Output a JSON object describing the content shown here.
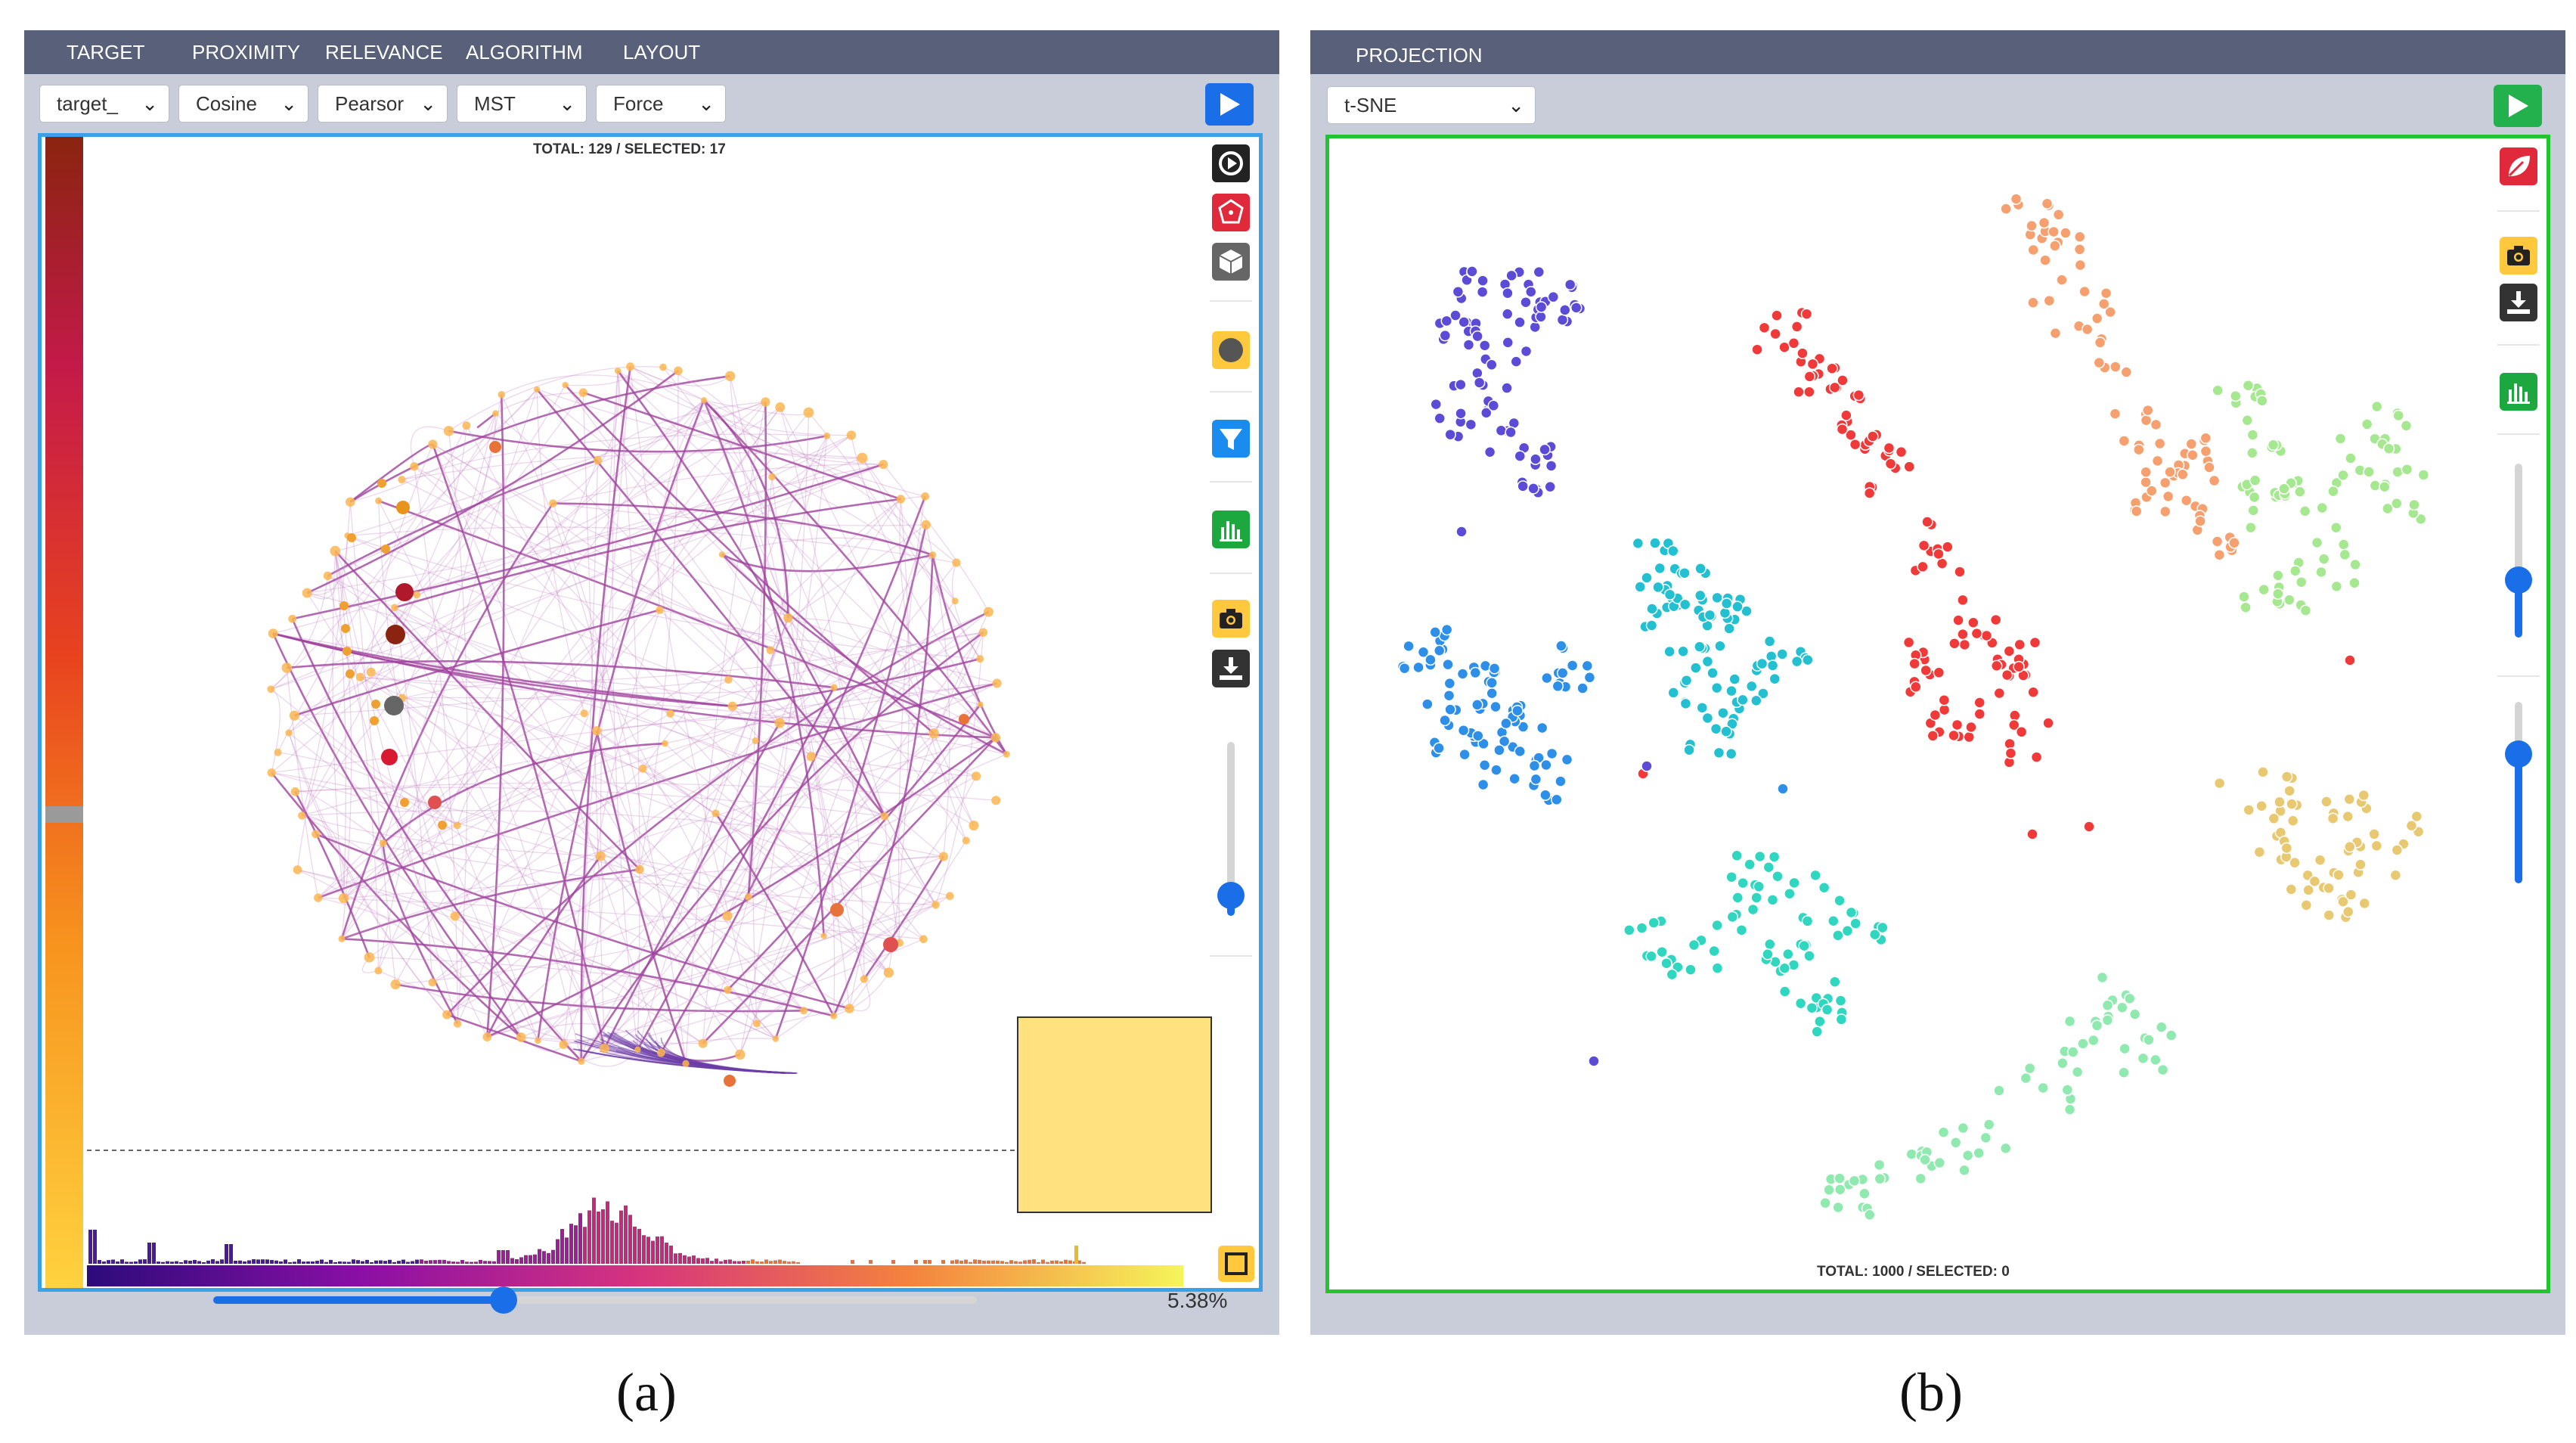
{
  "panel_a": {
    "tabs": [
      "TARGET",
      "PROXIMITY",
      "RELEVANCE",
      "ALGORITHM",
      "LAYOUT"
    ],
    "selects": {
      "target": "target_",
      "proximity": "Cosine",
      "relevance": "Pearsor",
      "algorithm": "MST",
      "layout": "Force"
    },
    "info": "TOTAL: 129  / SELECTED: 17",
    "threshold": {
      "value": 0.38,
      "label": "5.38%"
    },
    "colors": {
      "accent": "#1a6fe8",
      "border": "#3aa0e8",
      "edge": "#b35fb0"
    },
    "toolbar_icons": [
      "play-icon",
      "dice-icon",
      "cube-icon",
      "circle-icon",
      "filter-icon",
      "histogram-icon",
      "camera-icon",
      "download-icon"
    ],
    "side_slider": {
      "value": 0.15
    }
  },
  "panel_b": {
    "tabs": [
      "PROJECTION"
    ],
    "selects": {
      "projection": "t-SNE"
    },
    "info": "TOTAL: 1000   / SELECTED: 0",
    "colors": {
      "accent": "#22b14c",
      "border": "#22c52f"
    },
    "toolbar_icons": [
      "leaf-icon",
      "camera-icon",
      "download-icon",
      "histogram-icon"
    ],
    "sliders": [
      {
        "value": 0.3
      },
      {
        "value": 0.75
      }
    ]
  },
  "captions": {
    "a": "(a)",
    "b": "(b)"
  }
}
